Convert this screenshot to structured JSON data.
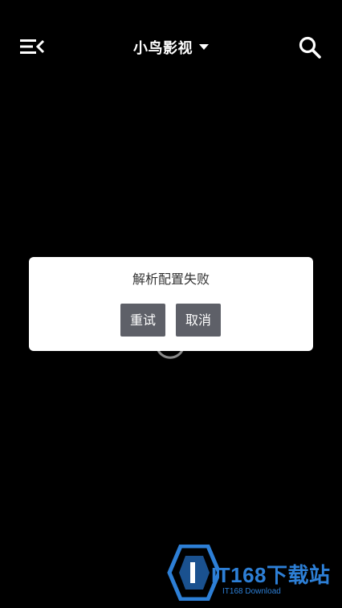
{
  "header": {
    "title": "小鸟影视",
    "menu_icon": "menu-collapse-icon",
    "caret_icon": "caret-down-icon",
    "search_icon": "search-icon"
  },
  "dialog": {
    "message": "解析配置失败",
    "retry_label": "重试",
    "cancel_label": "取消"
  },
  "watermark": {
    "brand": "IT168下载站",
    "subtitle": "IT168 Download"
  },
  "colors": {
    "background": "#000000",
    "dialog_background": "#ffffff",
    "button_background": "#5e6068",
    "watermark": "#2d7fd6"
  }
}
